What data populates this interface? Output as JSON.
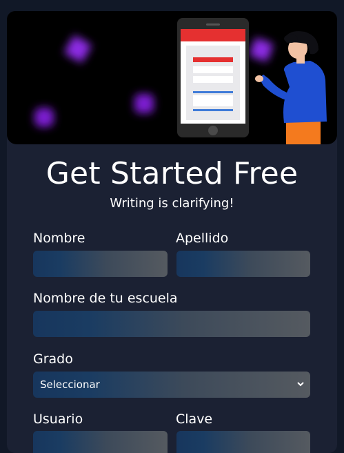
{
  "header": {
    "title": "Get Started Free",
    "subtitle": "Writing is clarifying!"
  },
  "form": {
    "nombre_label": "Nombre",
    "apellido_label": "Apellido",
    "escuela_label": "Nombre de tu escuela",
    "grado_label": "Grado",
    "grado_value": "Seleccionar",
    "usuario_label": "Usuario",
    "clave_label": "Clave"
  },
  "colors": {
    "page_bg": "#111827",
    "card_bg": "#1b2133",
    "accent_red": "#e53030",
    "accent_blue": "#1f4fd1",
    "glow_purple": "#8b2be2"
  },
  "icons": {
    "select_arrow": "chevron-down-icon"
  }
}
